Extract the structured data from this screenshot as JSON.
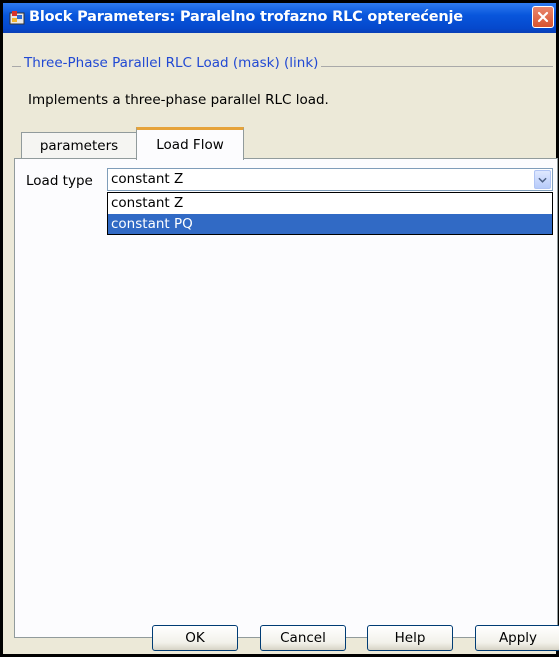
{
  "window": {
    "title": "Block Parameters: Paralelno trofazno RLC opterećenje"
  },
  "mask": {
    "group_title": "Three-Phase Parallel RLC Load (mask) (link)",
    "description": "Implements a three-phase parallel RLC load."
  },
  "tabs": [
    {
      "label": "parameters",
      "selected": false
    },
    {
      "label": "Load Flow",
      "selected": true
    }
  ],
  "load_type": {
    "label": "Load type",
    "value": "constant Z",
    "options": [
      "constant Z",
      "constant PQ"
    ],
    "highlighted_option": "constant PQ"
  },
  "buttons": {
    "ok": "OK",
    "cancel": "Cancel",
    "help": "Help",
    "apply": "Apply"
  },
  "colors": {
    "titlebar": "#0856dc",
    "group_title_text": "#2149d3",
    "selection": "#316ac5",
    "dialog_background": "#ece9d8"
  },
  "icons": {
    "app": "simulink-block-icon",
    "close": "close-icon",
    "dropdown": "chevron-down-icon"
  }
}
